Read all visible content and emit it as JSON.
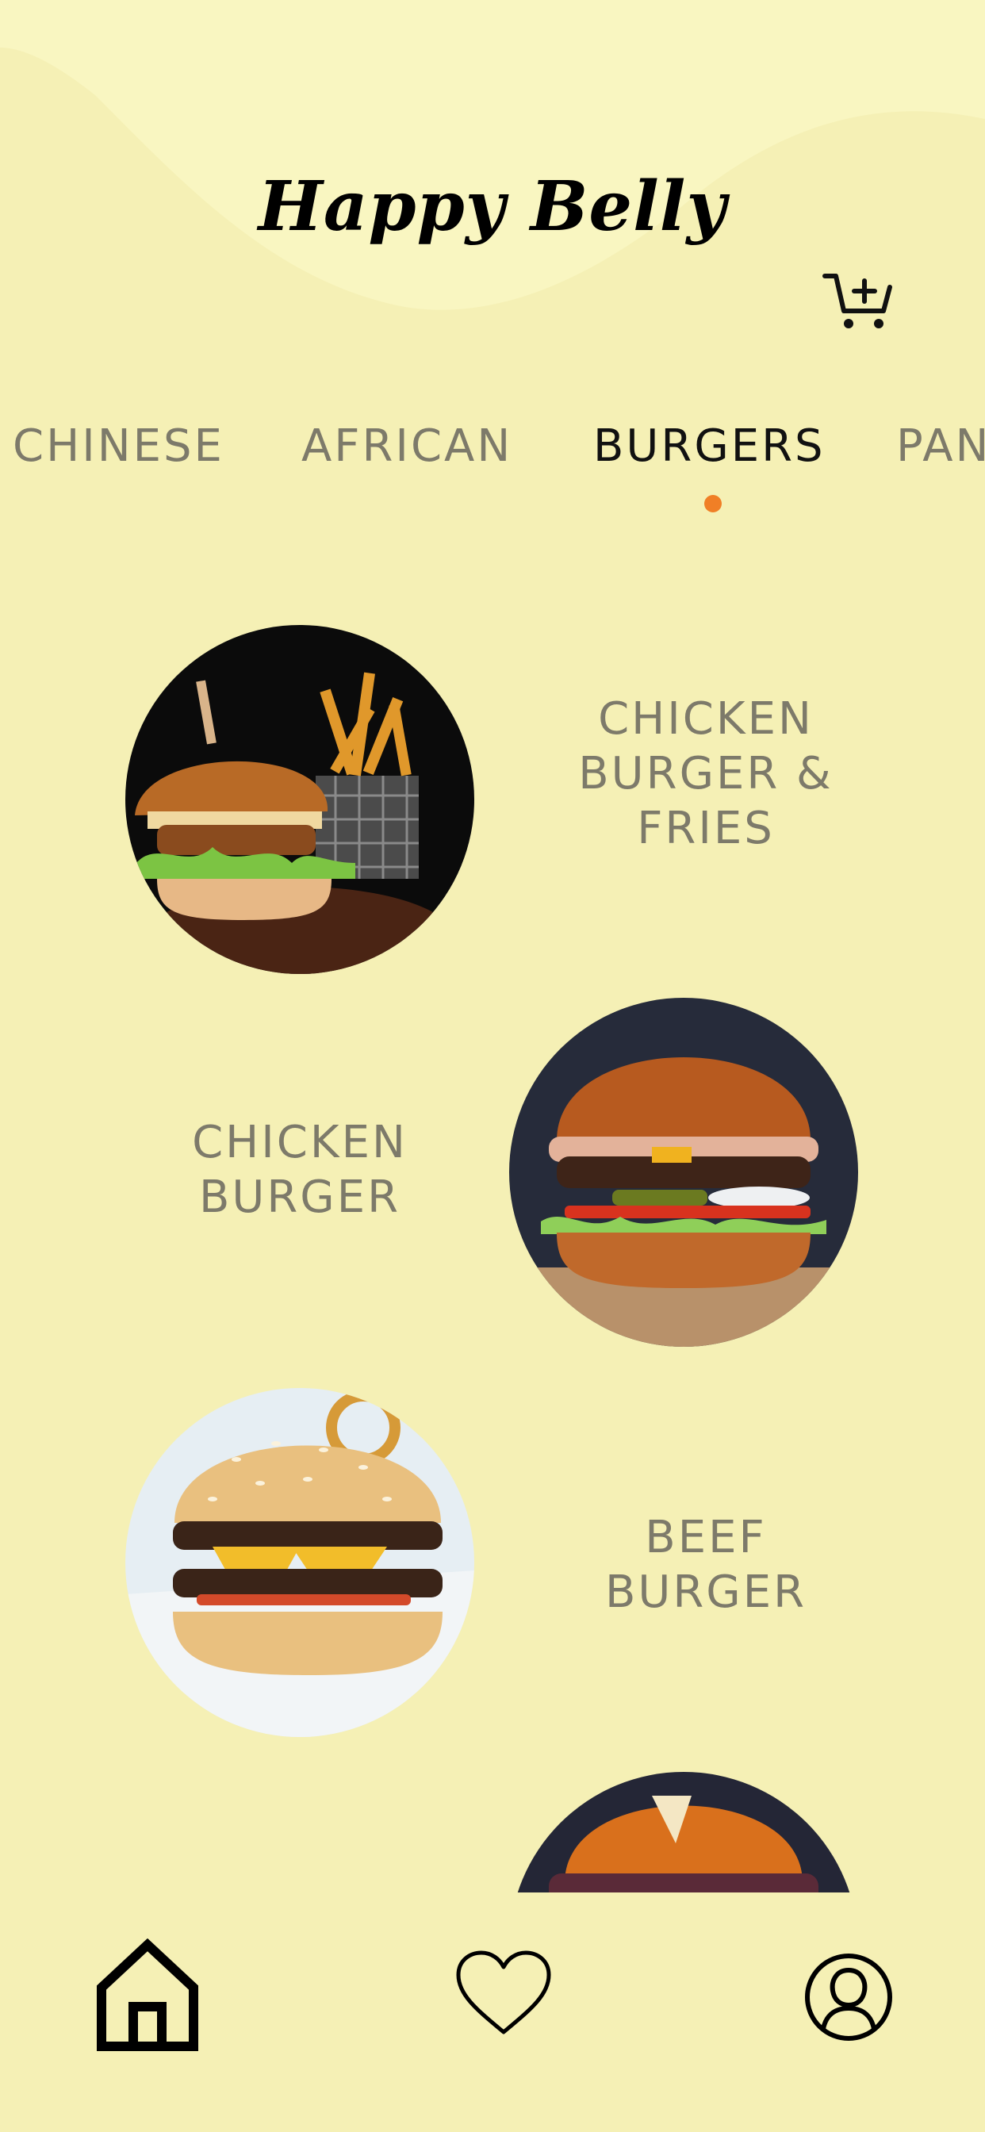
{
  "app": {
    "brand": "Happy Belly"
  },
  "header": {
    "cart_icon": "cart-add-icon"
  },
  "categories": [
    {
      "label": "CHINESE",
      "active": false
    },
    {
      "label": "AFRICAN",
      "active": false
    },
    {
      "label": "BURGERS",
      "active": true
    },
    {
      "label": "PAN",
      "active": false
    }
  ],
  "menu_items": [
    {
      "name": "CHICKEN BURGER & FRIES",
      "image": "chicken-burger-fries-photo"
    },
    {
      "name": "CHICKEN BURGER",
      "image": "chicken-burger-photo"
    },
    {
      "name": "BEEF BURGER",
      "image": "beef-burger-photo"
    },
    {
      "name": "",
      "image": "pretzel-burger-photo"
    }
  ],
  "bottom_nav": [
    {
      "icon": "home-icon",
      "active": true
    },
    {
      "icon": "heart-icon",
      "active": false
    },
    {
      "icon": "profile-icon",
      "active": false
    }
  ],
  "colors": {
    "background": "#f5f0b5",
    "accent": "#f07f26",
    "text_muted": "#7d7a6a",
    "text_active": "#111111"
  }
}
